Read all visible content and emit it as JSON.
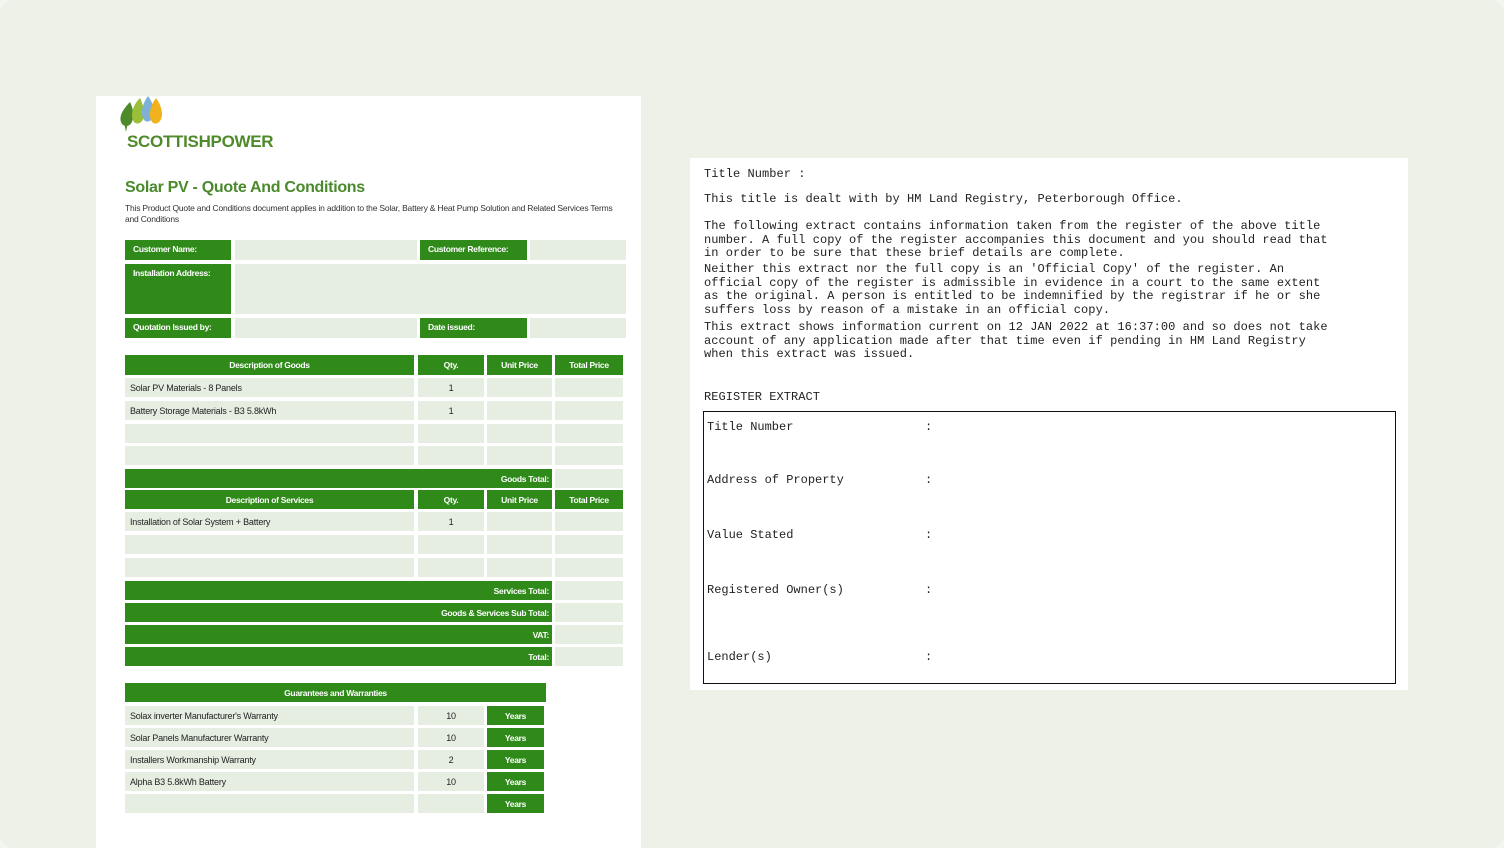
{
  "quote": {
    "brand": "SCOTTISHPOWER",
    "title": "Solar PV - Quote And Conditions",
    "intro": "This Product Quote and Conditions document applies in addition to the Solar, Battery & Heat Pump Solution and Related Services Terms and Conditions",
    "labels": {
      "customer_name": "Customer Name:",
      "customer_reference": "Customer Reference:",
      "installation_address": "Installation Address:",
      "quotation_issued_by": "Quotation Issued by:",
      "date_issued": "Date issued:"
    },
    "goods": {
      "headers": [
        "Description of Goods",
        "Qty.",
        "Unit Price",
        "Total Price"
      ],
      "rows": [
        {
          "desc": "Solar PV Materials - 8 Panels",
          "qty": "1"
        },
        {
          "desc": "Battery Storage Materials - B3 5.8kWh",
          "qty": "1"
        },
        {
          "desc": "",
          "qty": ""
        },
        {
          "desc": "",
          "qty": ""
        }
      ],
      "total_label": "Goods Total:"
    },
    "services": {
      "headers": [
        "Description of Services",
        "Qty.",
        "Unit Price",
        "Total Price"
      ],
      "rows": [
        {
          "desc": "Installation of Solar System + Battery",
          "qty": "1"
        },
        {
          "desc": "",
          "qty": ""
        },
        {
          "desc": "",
          "qty": ""
        }
      ],
      "total_label": "Services Total:"
    },
    "summary": [
      "Goods & Services Sub Total:",
      "VAT:",
      "Total:"
    ],
    "guarantees": {
      "header": "Guarantees and Warranties",
      "unit": "Years",
      "rows": [
        {
          "name": "Solax inverter Manufacturer's Warranty",
          "years": "10"
        },
        {
          "name": "Solar Panels Manufacturer Warranty",
          "years": "10"
        },
        {
          "name": "Installers Workmanship Warranty",
          "years": "2"
        },
        {
          "name": "Alpha B3 5.8kWh Battery",
          "years": "10"
        },
        {
          "name": "",
          "years": ""
        }
      ]
    }
  },
  "register": {
    "title_number_line": "Title Number :",
    "dealt_with": "This title is dealt with by HM Land Registry, Peterborough Office.",
    "para1": "The following extract contains information taken from the register of the above title\nnumber. A full copy of the register accompanies this document and you should read that\nin order to be sure that these brief details are complete.",
    "para2": "Neither this extract nor the full copy is an 'Official Copy' of the register. An\nofficial copy of the register is admissible in evidence in a court to the same extent\nas the original. A person is entitled to be indemnified by the registrar if he or she\nsuffers loss by reason of a mistake in an official copy.",
    "para3": "This extract shows information current on 12 JAN 2022 at 16:37:00 and so does not take\naccount of any application made after that time even if pending in HM Land Registry\nwhen this extract was issued.",
    "heading": "REGISTER EXTRACT",
    "fields": [
      "Title Number",
      "Address of Property",
      "Value Stated",
      "Registered Owner(s)",
      "Lender(s)"
    ],
    "separator": ":"
  }
}
